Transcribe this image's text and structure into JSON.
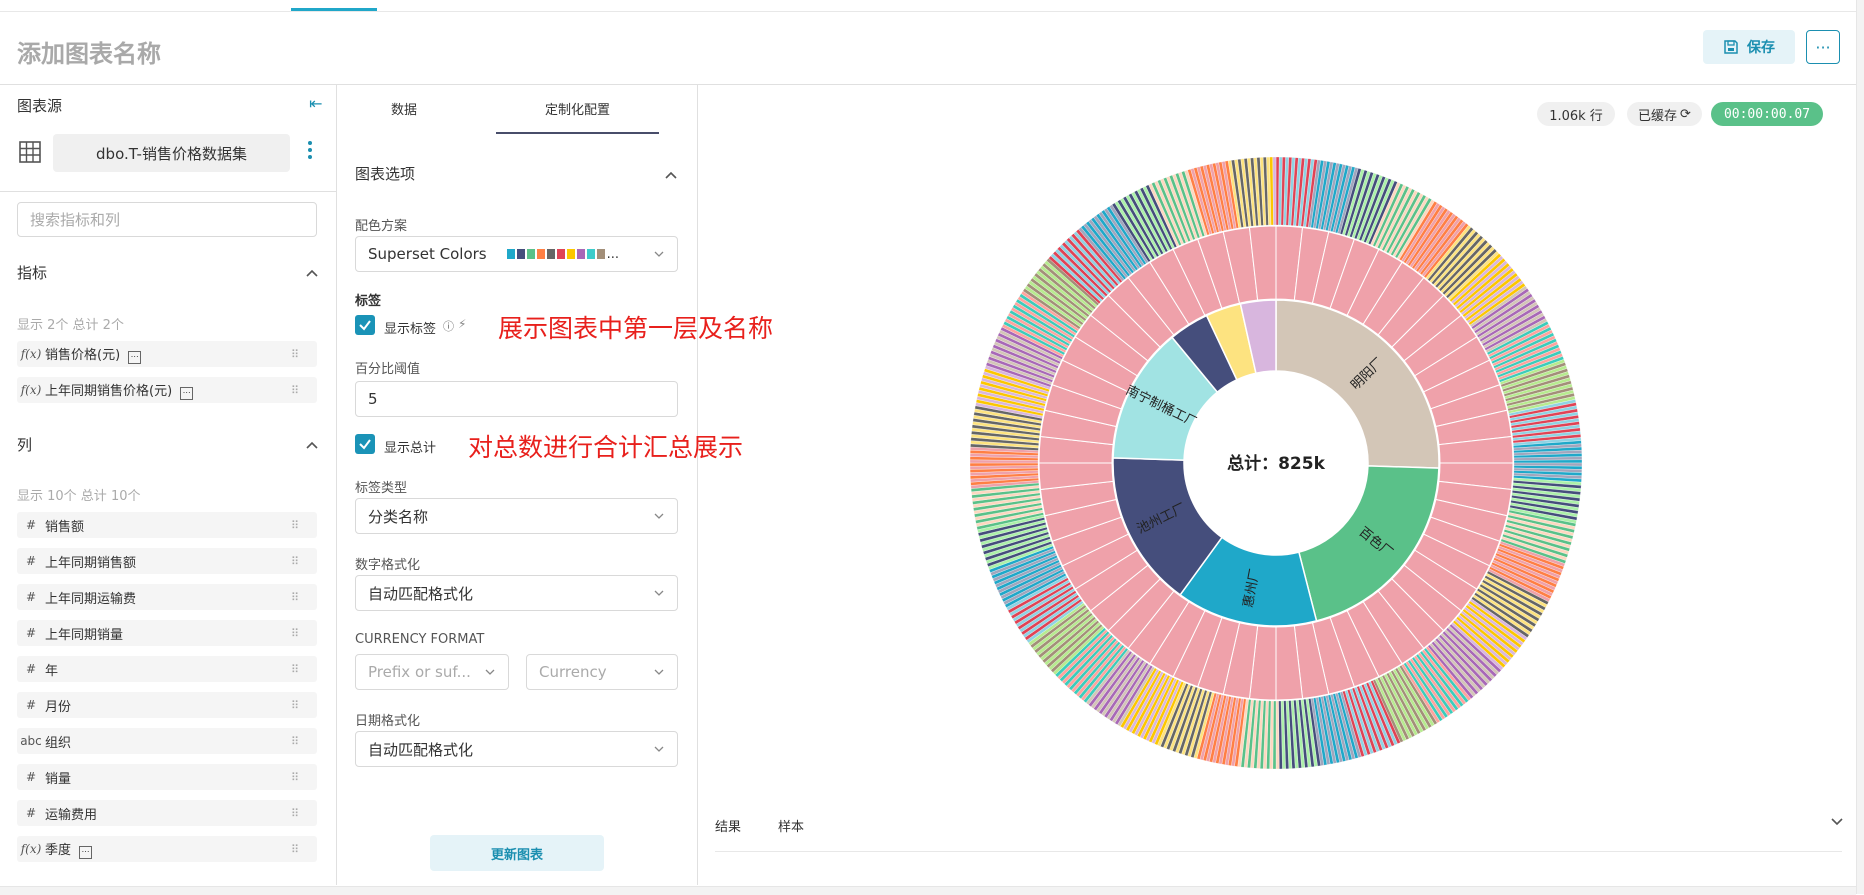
{
  "header": {
    "title": "添加图表名称",
    "save_label": "保存",
    "more_label": "···"
  },
  "datasource": {
    "label": "图表源",
    "name": "dbo.T-销售价格数据集",
    "search_placeholder": "搜索指标和列"
  },
  "metrics": {
    "title": "指标",
    "count_text": "显示 2个 总计 2个",
    "items": [
      {
        "type": "f(x)",
        "label": "销售价格(元)"
      },
      {
        "type": "f(x)",
        "label": "上年同期销售价格(元)"
      }
    ]
  },
  "columns": {
    "title": "列",
    "count_text": "显示 10个 总计 10个",
    "items": [
      {
        "type": "#",
        "label": "销售额"
      },
      {
        "type": "#",
        "label": "上年同期销售额"
      },
      {
        "type": "#",
        "label": "上年同期运输费"
      },
      {
        "type": "#",
        "label": "上年同期销量"
      },
      {
        "type": "#",
        "label": "年"
      },
      {
        "type": "#",
        "label": "月份"
      },
      {
        "type": "abc",
        "label": "组织"
      },
      {
        "type": "#",
        "label": "销量"
      },
      {
        "type": "#",
        "label": "运输费用"
      },
      {
        "type": "f(x)",
        "label": "季度"
      }
    ]
  },
  "config": {
    "tabs": [
      "数据",
      "定制化配置"
    ],
    "active_tab": "定制化配置",
    "section_title": "图表选项",
    "color_scheme_label": "配色方案",
    "color_scheme_value": "Superset Colors",
    "swatches": [
      "#1FA8C9",
      "#454E7C",
      "#5AC189",
      "#FF7F44",
      "#666666",
      "#E04355",
      "#FCC700",
      "#A868B7",
      "#3CCCCB",
      "#A38F79"
    ],
    "labels_heading": "标签",
    "show_labels_label": "显示标签",
    "show_labels_checked": true,
    "percent_threshold_label": "百分比阈值",
    "percent_threshold_value": "5",
    "show_total_label": "显示总计",
    "show_total_checked": true,
    "label_type_label": "标签类型",
    "label_type_value": "分类名称",
    "number_format_label": "数字格式化",
    "number_format_value": "自动匹配格式化",
    "currency_format_label": "CURRENCY FORMAT",
    "currency_prefix_placeholder": "Prefix or suf...",
    "currency_placeholder": "Currency",
    "date_format_label": "日期格式化",
    "date_format_value": "自动匹配格式化",
    "update_label": "更新图表"
  },
  "annotations": {
    "labels_note": "展示图表中第一层及名称",
    "total_note": "对总数进行合计汇总展示"
  },
  "status": {
    "rows": "1.06k 行",
    "cached": "已缓存",
    "timer": "00:00:00.07"
  },
  "results": {
    "tabs": [
      "结果",
      "样本"
    ]
  },
  "colors": {
    "accent": "#1b8fb0",
    "annotation": "#e8201c",
    "timer_bg": "#5ac189"
  },
  "chart_data": {
    "type": "sunburst",
    "total_label": "总计：825k",
    "inner_ring": [
      {
        "name": "明阳厂",
        "value": 0.255,
        "color": "#d3c6b7"
      },
      {
        "name": "百色厂",
        "value": 0.205,
        "color": "#5ac189"
      },
      {
        "name": "惠州厂",
        "value": 0.14,
        "color": "#1fa8c9"
      },
      {
        "name": "池州工厂",
        "value": 0.155,
        "color": "#454e7c"
      },
      {
        "name": "南宁制桶工厂",
        "value": 0.135,
        "color": "#a1e3e3"
      },
      {
        "name": "",
        "value": 0.04,
        "color": "#454e7c"
      },
      {
        "name": "",
        "value": 0.035,
        "color": "#fde380"
      },
      {
        "name": "",
        "value": 0.035,
        "color": "#d8b6de"
      }
    ],
    "middle_ring_color": "#efa1aa",
    "middle_ring_segments": 56,
    "outer_ring_segments": 600,
    "outer_palette": [
      "#e04355",
      "#1fa8c9",
      "#454e7c",
      "#5ac189",
      "#ff7f44",
      "#666666",
      "#fcc700",
      "#a868b7",
      "#3cccbb",
      "#a38f79",
      "#8fd3e4",
      "#a1a6bd",
      "#acf1a9",
      "#fdd8c0",
      "#efa1aa",
      "#fde380",
      "#d8b6de",
      "#d3c6b7",
      "#ffa39e",
      "#b7eb8f"
    ]
  }
}
